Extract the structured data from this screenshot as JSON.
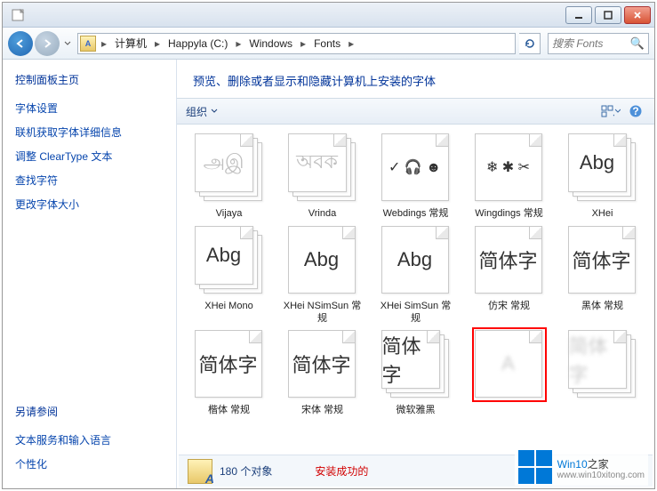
{
  "titlebar": {},
  "nav": {
    "crumbs": [
      "计算机",
      "Happyla (C:)",
      "Windows",
      "Fonts"
    ],
    "search_placeholder": "搜索 Fonts"
  },
  "sidebar": {
    "heading": "控制面板主页",
    "links": [
      "字体设置",
      "联机获取字体详细信息",
      "调整 ClearType 文本",
      "查找字符",
      "更改字体大小"
    ],
    "see_also_heading": "另请参阅",
    "see_also": [
      "文本服务和输入语言",
      "个性化"
    ]
  },
  "main": {
    "title": "预览、删除或者显示和隐藏计算机上安装的字体",
    "organize": "组织"
  },
  "fonts": [
    {
      "glyph": "அஇ",
      "label": "Vijaya",
      "stack": true,
      "dim": true
    },
    {
      "glyph": "অবক",
      "label": "Vrinda",
      "stack": true,
      "dim": true
    },
    {
      "glyph": "✓ 🎧 ☻",
      "label": "Webdings 常规",
      "stack": false,
      "sm": true
    },
    {
      "glyph": "❄ ✱ ✂",
      "label": "Wingdings 常规",
      "stack": false,
      "sm": true
    },
    {
      "glyph": "Abg",
      "label": "XHei",
      "stack": true
    },
    {
      "glyph": "Abg",
      "label": "XHei Mono",
      "stack": true
    },
    {
      "glyph": "Abg",
      "label": "XHei NSimSun 常规",
      "stack": false
    },
    {
      "glyph": "Abg",
      "label": "XHei SimSun 常规",
      "stack": false
    },
    {
      "glyph": "简体字",
      "label": "仿宋 常规",
      "stack": false
    },
    {
      "glyph": "简体字",
      "label": "黑体 常规",
      "stack": false
    },
    {
      "glyph": "简体字",
      "label": "楷体 常规",
      "stack": false
    },
    {
      "glyph": "简体字",
      "label": "宋体 常规",
      "stack": false
    },
    {
      "glyph": "简体字",
      "label": "微软雅黑",
      "stack": true
    },
    {
      "glyph": "A",
      "label": "",
      "stack": false,
      "selected": true,
      "blurred": true
    },
    {
      "glyph": "简体字",
      "label": "",
      "stack": true,
      "blurred": true
    }
  ],
  "status": {
    "count": "180 个对象",
    "message": "安装成功的"
  },
  "watermark": {
    "brand": "Win10",
    "suffix": "之家",
    "url": "www.win10xitong.com"
  }
}
